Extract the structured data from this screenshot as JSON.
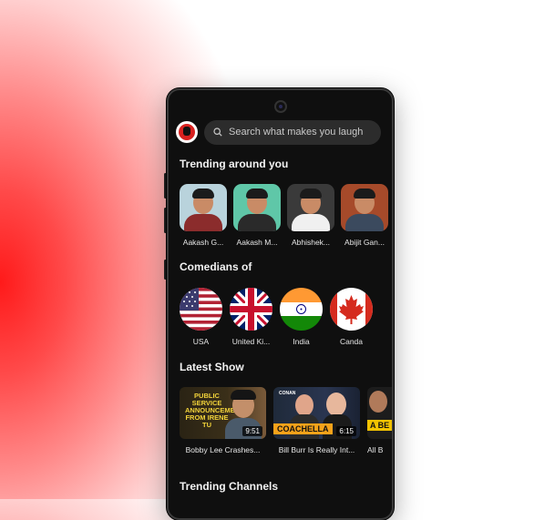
{
  "search": {
    "placeholder": "Search what makes you laugh"
  },
  "sections": {
    "trending": "Trending around you",
    "comedians_of": "Comedians of",
    "latest_show": "Latest Show",
    "trending_channels": "Trending Channels"
  },
  "comedians": [
    {
      "name": "Aakash G...",
      "bg": "#b9d3dc",
      "shirt": "#8b2c2c"
    },
    {
      "name": "Aakash M...",
      "bg": "#5fc7a8",
      "shirt": "#2a2a2a"
    },
    {
      "name": "Abhishek...",
      "bg": "#3a3a3a",
      "shirt": "#f0f0f0"
    },
    {
      "name": "Abijit Gan...",
      "bg": "#a64a2a",
      "shirt": "#3b4a5e"
    }
  ],
  "countries": [
    {
      "name": "USA"
    },
    {
      "name": "United Ki..."
    },
    {
      "name": "India"
    },
    {
      "name": "Canda"
    }
  ],
  "shows": [
    {
      "title": "Bobby Lee Crashes...",
      "duration": "9:51",
      "thumb_text": "PUBLIC SERVICE ANNOUNCEMENT FROM IRENE TU"
    },
    {
      "title": "Bill Burr Is Really Int...",
      "duration": "6:15",
      "thumb_text": "COACHELLA"
    },
    {
      "title": "All B",
      "duration": "",
      "thumb_text": "A BE"
    }
  ],
  "colors": {
    "accent": "#d8211f",
    "phone_bg": "#0f0f0f",
    "search_bg": "#2c2c2c"
  }
}
